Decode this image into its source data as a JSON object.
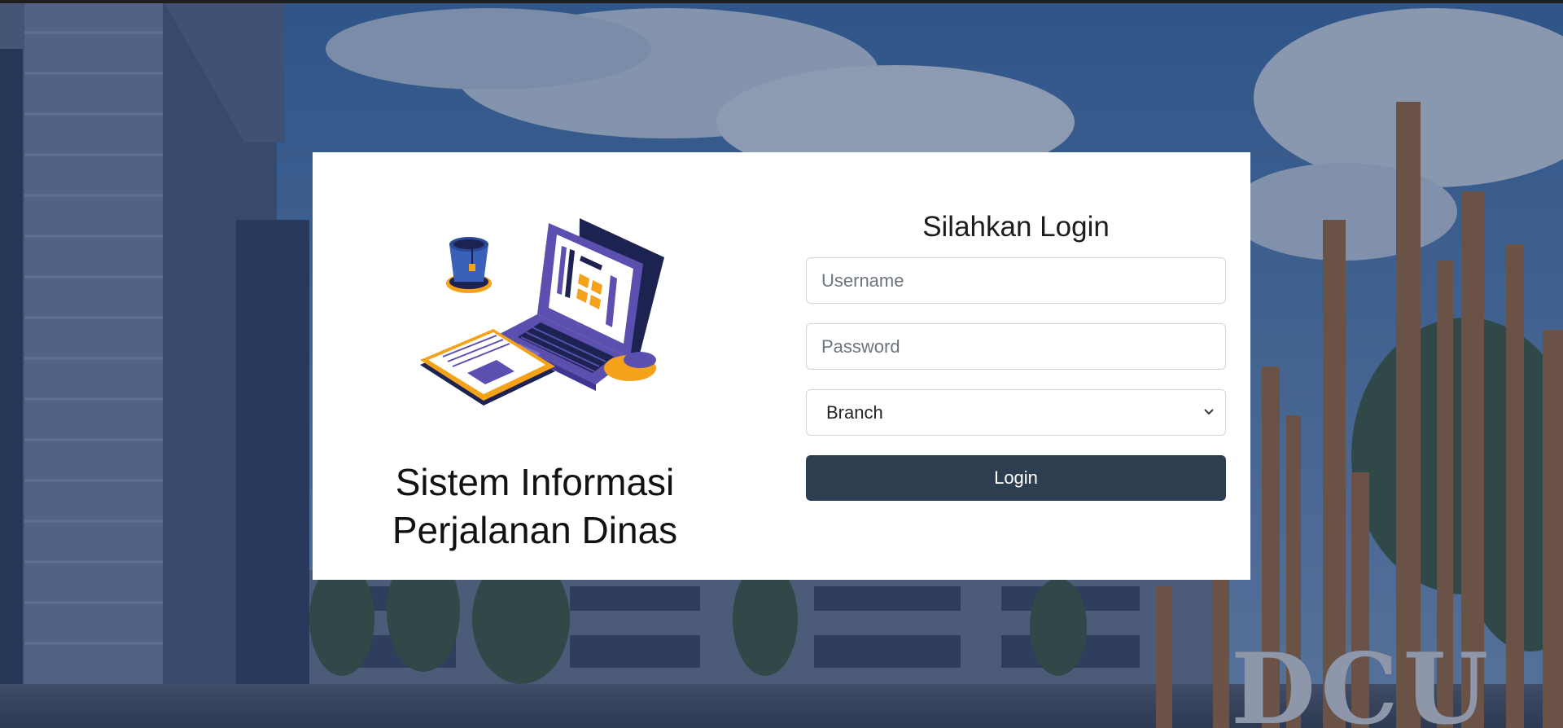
{
  "app": {
    "title_line1": "Sistem Informasi",
    "title_line2": "Perjalanan Dinas"
  },
  "login": {
    "heading": "Silahkan Login",
    "username_placeholder": "Username",
    "password_placeholder": "Password",
    "branch_selected": "Branch",
    "submit_label": "Login"
  },
  "background": {
    "sign_text": "DCU"
  },
  "colors": {
    "button": "#2c3e50",
    "card": "#ffffff",
    "overlay": "#182c56",
    "illustration_purple": "#5b4fb0",
    "illustration_orange": "#f5a21b",
    "illustration_navy": "#1d2350"
  }
}
